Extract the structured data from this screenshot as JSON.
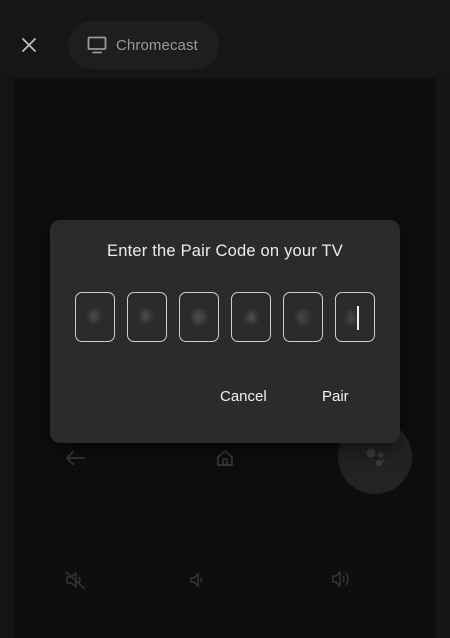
{
  "topbar": {
    "close_icon": "close-icon",
    "device_icon": "tv-icon",
    "device_name": "Chromecast"
  },
  "remote": {
    "icons": [
      "back-arrow-icon",
      "home-icon",
      "google-assistant-icon",
      "mute-icon",
      "volume-down-icon",
      "volume-up-icon"
    ]
  },
  "dialog": {
    "title": "Enter the Pair Code on your TV",
    "code": [
      "F",
      "F",
      "D",
      "4",
      "C",
      "1"
    ],
    "cancel_label": "Cancel",
    "pair_label": "Pair"
  },
  "colors": {
    "background": "#151515",
    "dialog": "#2b2b2b",
    "text": "#ececec",
    "muted": "#9a9a9a"
  }
}
